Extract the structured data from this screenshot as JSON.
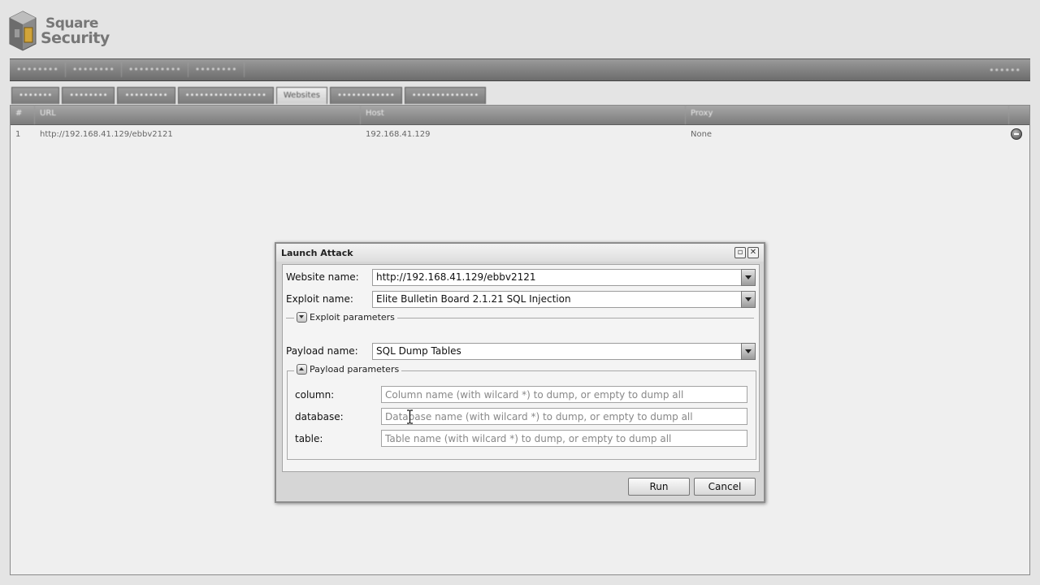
{
  "logo": {
    "line1": "Square",
    "line2": "Security"
  },
  "menubar": {
    "items": [
      "••••••••",
      "••••••••",
      "••••••••••",
      "••••••••"
    ],
    "right": "••••••"
  },
  "tabs": [
    {
      "label": "•••••••",
      "active": false
    },
    {
      "label": "••••••••",
      "active": false
    },
    {
      "label": "•••••••••",
      "active": false
    },
    {
      "label": "•••••••••••••••••",
      "active": false
    },
    {
      "label": "Websites",
      "active": true
    },
    {
      "label": "••••••••••••",
      "active": false
    },
    {
      "label": "••••••••••••••",
      "active": false
    }
  ],
  "grid": {
    "columns": [
      "#",
      "URL",
      "Host",
      "Proxy"
    ],
    "rows": [
      {
        "num": "1",
        "url": "http://192.168.41.129/ebbv2121",
        "host": "192.168.41.129",
        "proxy": "None"
      }
    ]
  },
  "dialog": {
    "title": "Launch Attack",
    "website_label": "Website name:",
    "website_value": "http://192.168.41.129/ebbv2121",
    "exploit_label": "Exploit name:",
    "exploit_value": "Elite Bulletin Board 2.1.21 SQL Injection",
    "exploit_params_legend": "Exploit parameters",
    "payload_label": "Payload name:",
    "payload_value": "SQL Dump Tables",
    "payload_params_legend": "Payload parameters",
    "params": [
      {
        "label": "column:",
        "placeholder": "Column name (with wilcard *) to dump, or empty to dump all"
      },
      {
        "label": "database:",
        "placeholder": "Database name (with wilcard *) to dump, or empty to dump all"
      },
      {
        "label": "table:",
        "placeholder": "Table name (with wilcard *) to dump, or empty to dump all"
      }
    ],
    "run_label": "Run",
    "cancel_label": "Cancel"
  }
}
